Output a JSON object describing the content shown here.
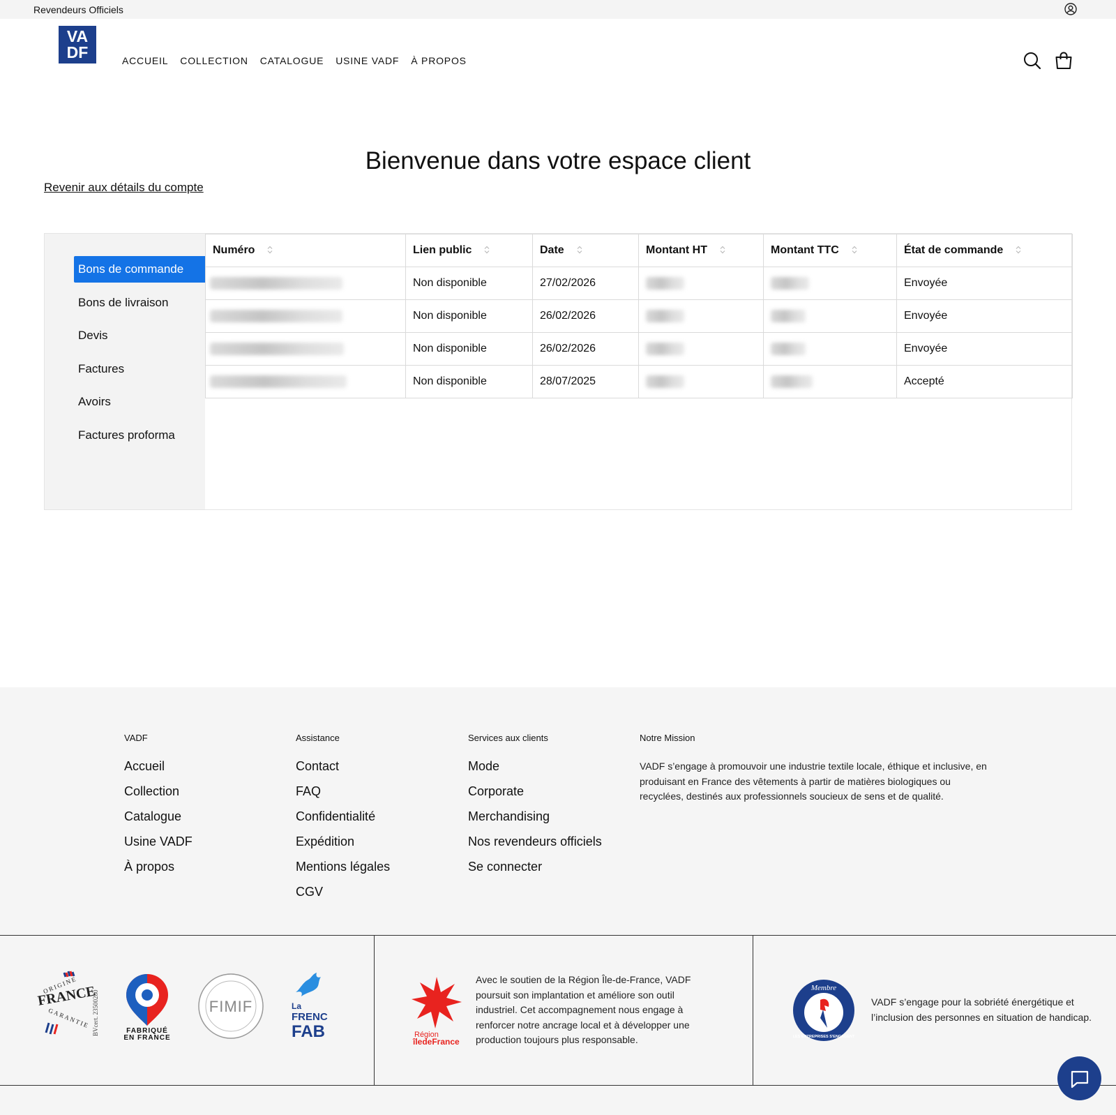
{
  "topbar": {
    "announcement": "Revendeurs Officiels",
    "account_icon": "user-circle-icon"
  },
  "header": {
    "logo": {
      "line1": "VA",
      "line2": "DF"
    },
    "nav": [
      "ACCUEIL",
      "COLLECTION",
      "CATALOGUE",
      "USINE VADF",
      "À PROPOS"
    ],
    "search_icon": "search-icon",
    "cart_icon": "shopping-bag-icon"
  },
  "page": {
    "title": "Bienvenue dans votre espace client",
    "back_link": "Revenir aux détails du compte"
  },
  "sidebar": {
    "items": [
      "Bons de commande",
      "Bons de livraison",
      "Devis",
      "Factures",
      "Avoirs",
      "Factures proforma"
    ],
    "active_index": 0,
    "active_color": "#1473e6"
  },
  "orders_table": {
    "columns": [
      "Numéro",
      "Lien public",
      "Date",
      "Montant HT",
      "Montant TTC",
      "État de commande"
    ],
    "rows": [
      {
        "lien": "Non disponible",
        "date": "27/02/2026",
        "etat": "Envoyée"
      },
      {
        "lien": "Non disponible",
        "date": "26/02/2026",
        "etat": "Envoyée"
      },
      {
        "lien": "Non disponible",
        "date": "26/02/2026",
        "etat": "Envoyée"
      },
      {
        "lien": "Non disponible",
        "date": "28/07/2025",
        "etat": "Accepté"
      }
    ]
  },
  "footer": {
    "col_vadf": {
      "title": "VADF",
      "links": [
        "Accueil",
        "Collection",
        "Catalogue",
        "Usine VADF",
        "À propos"
      ]
    },
    "col_assistance": {
      "title": "Assistance",
      "links": [
        "Contact",
        "FAQ",
        "Confidentialité",
        "Expédition",
        "Mentions légales",
        "CGV"
      ]
    },
    "col_services": {
      "title": "Services aux clients",
      "links": [
        "Mode",
        "Corporate",
        "Merchandising",
        "Nos revendeurs officiels",
        "Se connecter"
      ]
    },
    "mission": {
      "title": "Notre Mission",
      "text": "VADF s’engage à promouvoir une industrie textile locale, éthique et inclusive, en produisant en France des vêtements à partir de matières biologiques ou recyclées, destinés aux professionnels soucieux de sens et de qualité."
    },
    "badges": {
      "origine": {
        "top": "ORIGINE",
        "main": "FRANCE",
        "bottom": "GARANTIE",
        "cert": "BVcert. 23500280"
      },
      "fabrique": {
        "line1": "FABRIQUÉ",
        "line2": "EN FRANCE"
      },
      "fimif": "FIMIF",
      "frenchfab": {
        "line1": "La",
        "line2": "FRENCH",
        "line3": "FAB"
      },
      "region": {
        "line1": "Région",
        "line2": "îledeFrance"
      },
      "membre": {
        "top": "Membre",
        "ring": "LES ENTREPRISES S'ENGAGENT"
      }
    },
    "region_text": "Avec le soutien de la Région Île-de-France, VADF poursuit son implantation et améliore son outil industriel. Cet accompagnement nous engage à renforcer notre ancrage local et à développer une production toujours plus responsable.",
    "engage_text": "VADF s’engage pour la sobriété énergétique et l’inclusion des personnes en situation de handicap."
  },
  "chat": {
    "icon": "chat-bubble-icon"
  },
  "colors": {
    "brand_navy": "#1d3f8c",
    "accent_blue": "#1473e6",
    "region_red": "#e8231f"
  }
}
